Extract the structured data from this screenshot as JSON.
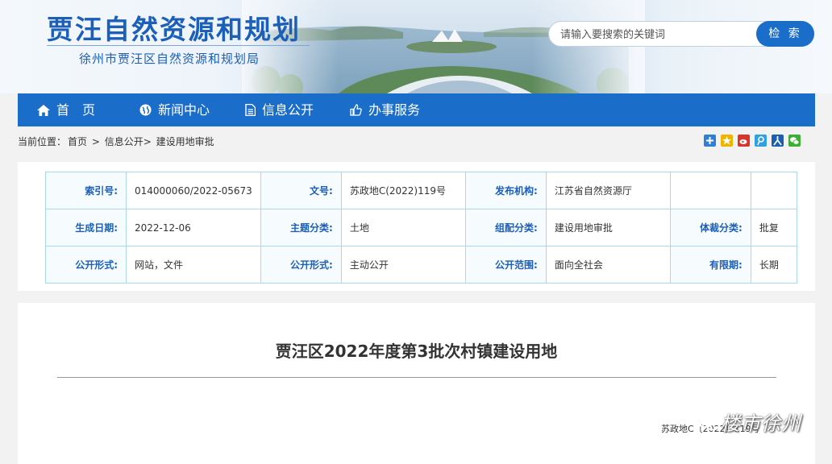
{
  "header": {
    "site_title": "贾汪自然资源和规划",
    "site_subtitle": "徐州市贾汪区自然资源和规划局",
    "search_placeholder": "请输入要搜索的关键词",
    "search_button": "检 索"
  },
  "nav": {
    "items": [
      {
        "label": "首　页",
        "icon": "home-icon"
      },
      {
        "label": "新闻中心",
        "icon": "globe-icon"
      },
      {
        "label": "信息公开",
        "icon": "document-icon"
      },
      {
        "label": "办事服务",
        "icon": "thumbs-up-icon"
      }
    ]
  },
  "breadcrumb": {
    "prefix": "当前位置：",
    "items": [
      "首页",
      ">",
      "信息公开>",
      "建设用地审批"
    ]
  },
  "share": {
    "icons": [
      {
        "name": "add-icon",
        "color": "#2f7fd4"
      },
      {
        "name": "qzone-icon",
        "color": "#f0b400"
      },
      {
        "name": "weibo-icon",
        "color": "#d9352b"
      },
      {
        "name": "tencent-weibo-icon",
        "color": "#2fa0e0"
      },
      {
        "name": "renren-icon",
        "color": "#1a5fb0"
      },
      {
        "name": "wechat-icon",
        "color": "#3cb034"
      }
    ]
  },
  "meta": {
    "rows": [
      [
        {
          "k": "索引号:",
          "v": "014000060/2022-05673"
        },
        {
          "k": "文号:",
          "v": "苏政地C(2022)119号"
        },
        {
          "k": "发布机构:",
          "v": "江苏省自然资源厅"
        },
        {
          "k": "",
          "v": ""
        }
      ],
      [
        {
          "k": "生成日期:",
          "v": "2022-12-06"
        },
        {
          "k": "主题分类:",
          "v": "土地"
        },
        {
          "k": "组配分类:",
          "v": "建设用地审批"
        },
        {
          "k": "体裁分类:",
          "v": "批复"
        }
      ],
      [
        {
          "k": "公开形式:",
          "v": "网站，文件"
        },
        {
          "k": "公开形式:",
          "v": "主动公开"
        },
        {
          "k": "公开范围:",
          "v": "面向全社会"
        },
        {
          "k": "有限期:",
          "v": "长期"
        }
      ]
    ]
  },
  "article": {
    "title": "贾汪区2022年度第3批次村镇建设用地",
    "doc_ref": "苏政地C〔2022〕119号",
    "watermark": "楼市徐州"
  }
}
